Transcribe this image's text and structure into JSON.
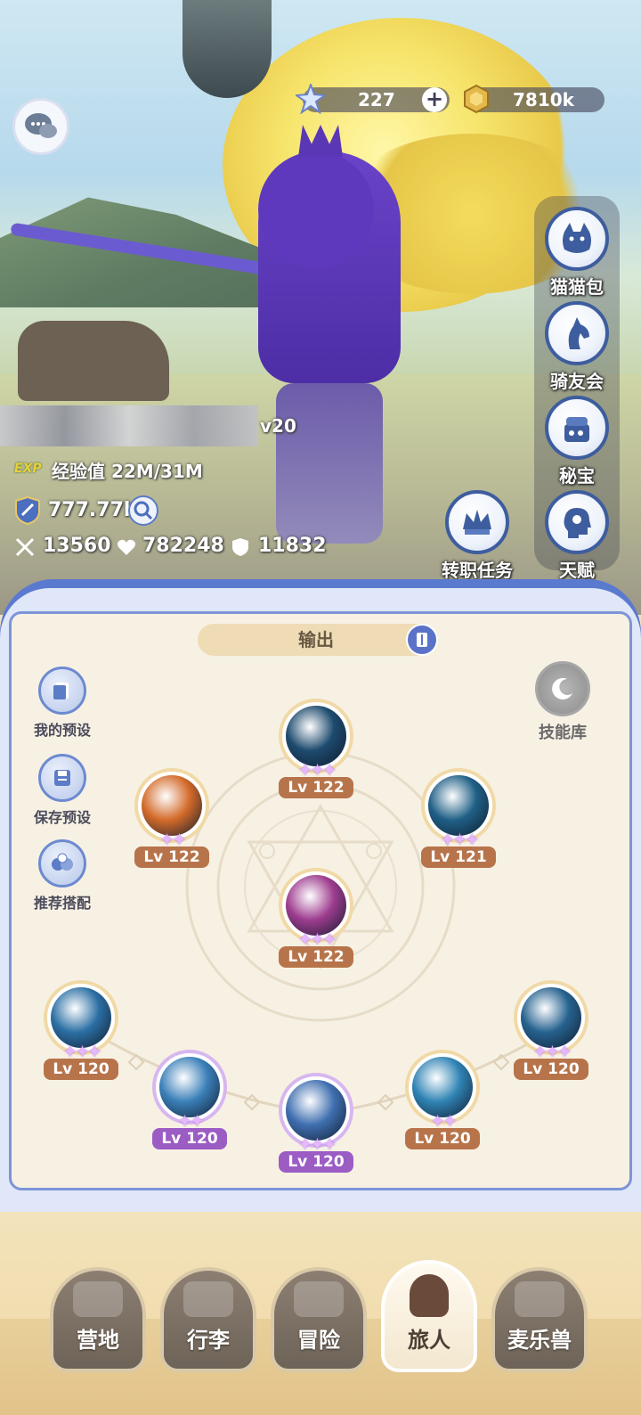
{
  "resources": {
    "gems": "227",
    "gold": "7810k"
  },
  "character": {
    "level": "v20",
    "exp_tag": "EXP",
    "exp_text": "经验值 22M/31M",
    "power": "777.77k",
    "attack": "13560",
    "hp": "782248",
    "defense": "11832"
  },
  "right_menu": [
    {
      "label": "猫猫包",
      "icon": "cat-bag-icon"
    },
    {
      "label": "骑友会",
      "icon": "horse-icon"
    },
    {
      "label": "秘宝",
      "icon": "treasure-icon"
    },
    {
      "label": "天赋",
      "icon": "brain-icon"
    }
  ],
  "job_quest": {
    "label": "转职任务",
    "icon": "crown-badge-icon"
  },
  "skill_panel": {
    "tab_label": "输出",
    "side_buttons": [
      {
        "label": "我的预设",
        "icon": "preset-icon"
      },
      {
        "label": "保存预设",
        "icon": "save-icon"
      },
      {
        "label": "推荐搭配",
        "icon": "recommend-icon"
      }
    ],
    "library_label": "技能库",
    "skills": [
      {
        "lv": "Lv 122",
        "stars": 3,
        "color": "#1d4a6e",
        "tier": "gold"
      },
      {
        "lv": "Lv 122",
        "stars": 2,
        "color": "#d36a2a",
        "tier": "gold"
      },
      {
        "lv": "Lv 121",
        "stars": 3,
        "color": "#1f5f86",
        "tier": "gold"
      },
      {
        "lv": "Lv 122",
        "stars": 3,
        "color": "#9d3c8e",
        "tier": "gold"
      },
      {
        "lv": "Lv 120",
        "stars": 3,
        "color": "#2b6fa4",
        "tier": "gold"
      },
      {
        "lv": "Lv 120",
        "stars": 2,
        "color": "#3a7fb8",
        "tier": "purple"
      },
      {
        "lv": "Lv 120",
        "stars": 3,
        "color": "#3f6fb0",
        "tier": "purple"
      },
      {
        "lv": "Lv 120",
        "stars": 2,
        "color": "#2f83b4",
        "tier": "gold"
      },
      {
        "lv": "Lv 120",
        "stars": 3,
        "color": "#26628f",
        "tier": "gold"
      }
    ]
  },
  "nav": [
    {
      "label": "营地",
      "icon": "castle-icon",
      "active": false
    },
    {
      "label": "行李",
      "icon": "chest-icon",
      "active": false
    },
    {
      "label": "冒险",
      "icon": "swords-icon",
      "active": false
    },
    {
      "label": "旅人",
      "icon": "traveler-icon",
      "active": true
    },
    {
      "label": "麦乐兽",
      "icon": "pet-icon",
      "active": false
    }
  ]
}
